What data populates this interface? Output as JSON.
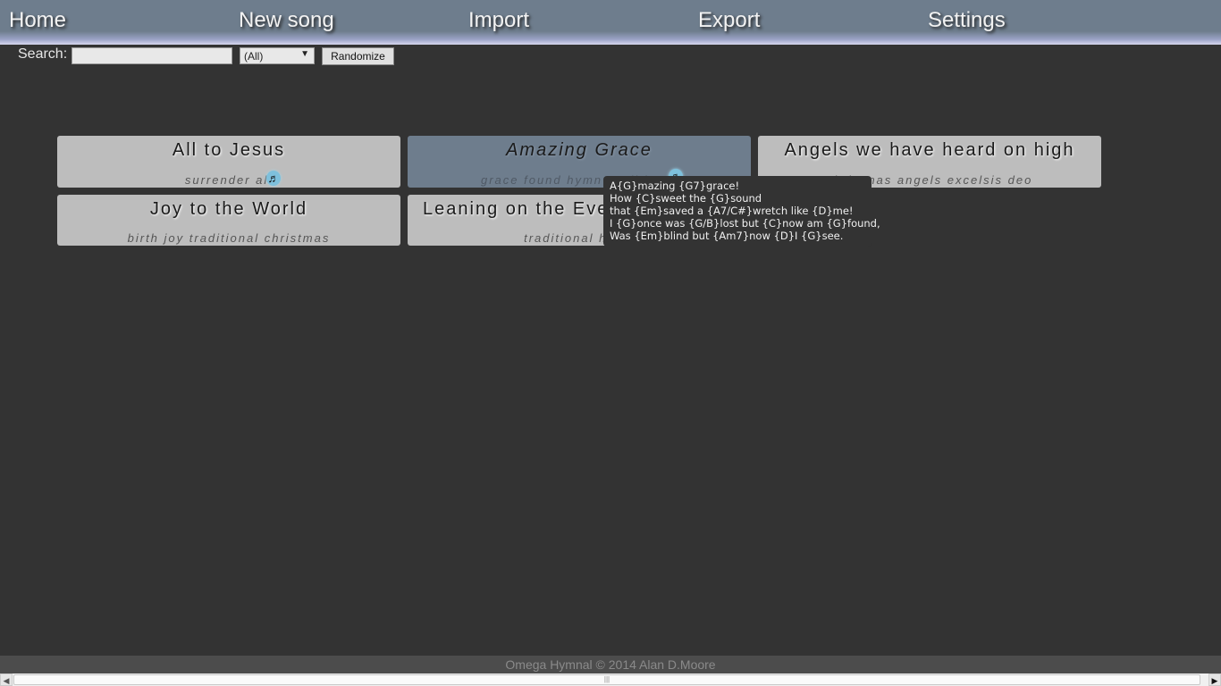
{
  "nav": {
    "items": [
      {
        "label": "Home"
      },
      {
        "label": "New song"
      },
      {
        "label": "Import"
      },
      {
        "label": "Export"
      },
      {
        "label": "Settings"
      }
    ]
  },
  "search": {
    "label": "Search:",
    "value": "",
    "placeholder": "",
    "category": "(All)",
    "randomize_label": "Randomize"
  },
  "songs": [
    {
      "title": "All to Jesus",
      "tags": "surrender all",
      "has_audio": true
    },
    {
      "title": "Amazing Grace",
      "tags": "grace found hymn traditional",
      "has_audio": true,
      "hovered": true
    },
    {
      "title": "Angels we have heard on high",
      "tags": "christmas angels excelsis deo",
      "has_audio": false
    },
    {
      "title": "Joy to the World",
      "tags": "birth joy traditional christmas",
      "has_audio": false
    },
    {
      "title": "Leaning on the Everlasting Arms",
      "tags": "traditional hymn",
      "has_audio": false
    }
  ],
  "tooltip": {
    "lines": [
      "A{G}mazing {G7}grace!",
      "How {C}sweet the {G}sound",
      "that {Em}saved a {A7/C#}wretch like {D}me!",
      "I {G}once was {G/B}lost but {C}now am {G}found,",
      "Was {Em}blind but {Am7}now {D}I {G}see."
    ]
  },
  "footer": {
    "text": "Omega Hymnal © 2014 Alan D.Moore"
  },
  "colors": {
    "background": "#333333",
    "navbar": "#6e7d8d",
    "card": "#bdbdbd",
    "card_hover": "#6e7d8d",
    "audio_icon": "#7ec0dc"
  }
}
